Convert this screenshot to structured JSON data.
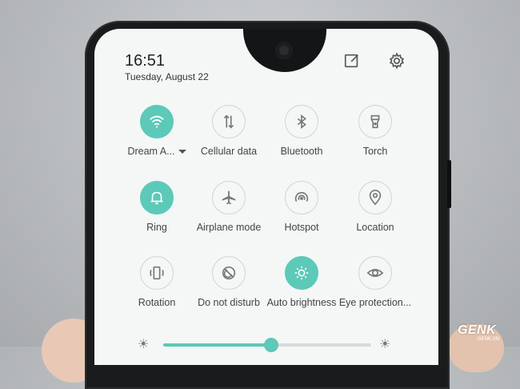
{
  "status": {
    "time": "16:51",
    "date": "Tuesday, August 22"
  },
  "header_icons": {
    "edit": "edit-icon",
    "settings": "gear-icon"
  },
  "accent_color": "#5cc9b9",
  "tiles": [
    {
      "label": "Dream A...",
      "icon": "wifi-icon",
      "active": true,
      "has_dropdown": true
    },
    {
      "label": "Cellular data",
      "icon": "cellular-data-icon",
      "active": false
    },
    {
      "label": "Bluetooth",
      "icon": "bluetooth-icon",
      "active": false
    },
    {
      "label": "Torch",
      "icon": "torch-icon",
      "active": false
    },
    {
      "label": "Ring",
      "icon": "bell-icon",
      "active": true
    },
    {
      "label": "Airplane mode",
      "icon": "airplane-icon",
      "active": false
    },
    {
      "label": "Hotspot",
      "icon": "hotspot-icon",
      "active": false
    },
    {
      "label": "Location",
      "icon": "location-pin-icon",
      "active": false
    },
    {
      "label": "Rotation",
      "icon": "rotation-icon",
      "active": false
    },
    {
      "label": "Do not disturb",
      "icon": "do-not-disturb-icon",
      "active": false
    },
    {
      "label": "Auto brightness",
      "icon": "sun-icon",
      "active": true
    },
    {
      "label": "Eye protection...",
      "icon": "eye-icon",
      "active": false
    }
  ],
  "brightness": {
    "level": 0.52
  },
  "watermark": {
    "text": "GENK",
    "sub": "GENK.VN"
  }
}
